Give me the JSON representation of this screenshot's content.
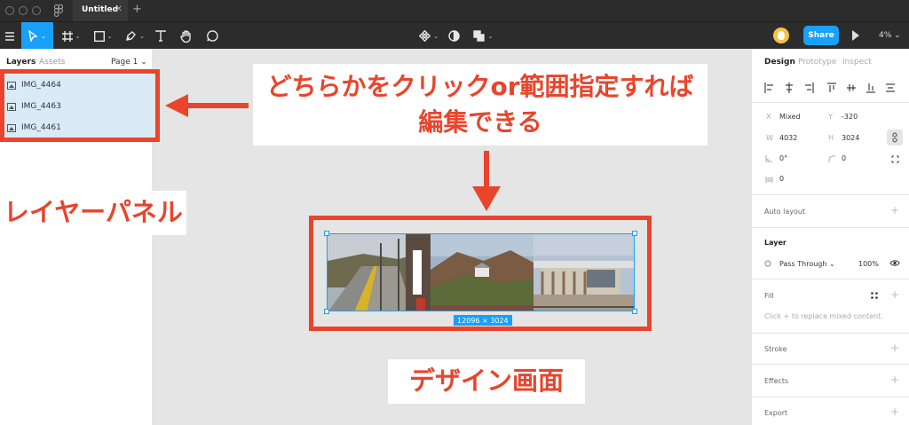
{
  "titlebar": {
    "tab_title": "Untitled",
    "tab_close": "✕",
    "new_tab": "+"
  },
  "toolbar": {
    "share_label": "Share",
    "zoom_label": "4%",
    "caret": "⌄"
  },
  "left_panel": {
    "tabs": {
      "layers": "Layers",
      "assets": "Assets"
    },
    "page_selector": "Page 1 ⌄",
    "layers": [
      {
        "label": "IMG_4464"
      },
      {
        "label": "IMG_4463"
      },
      {
        "label": "IMG_4461"
      }
    ]
  },
  "canvas": {
    "frame_dimensions": "12096 × 3024",
    "annotations": {
      "instruction_line1": "どちらかをクリックor範囲指定すれば",
      "instruction_line2": "編集できる",
      "layer_panel_label": "レイヤーパネル",
      "design_area_label": "デザイン画面"
    },
    "colors": {
      "annotation": "#e8452c",
      "selection": "#18a0fb"
    }
  },
  "right_panel": {
    "tabs": {
      "design": "Design",
      "prototype": "Prototype",
      "inspect": "Inspect"
    },
    "props": {
      "x_label": "X",
      "x_value": "Mixed",
      "y_label": "Y",
      "y_value": "-320",
      "w_label": "W",
      "w_value": "4032",
      "h_label": "H",
      "h_value": "3024",
      "rotation_value": "0°",
      "radius_value": "0",
      "spacing_value": "0"
    },
    "auto_layout": "Auto layout",
    "layer": {
      "title": "Layer",
      "blend_mode": "Pass Through ⌄",
      "opacity": "100%"
    },
    "fill": {
      "title": "Fill",
      "hint": "Click + to replace mixed content."
    },
    "stroke": "Stroke",
    "effects": "Effects",
    "export": "Export",
    "plus": "+"
  }
}
